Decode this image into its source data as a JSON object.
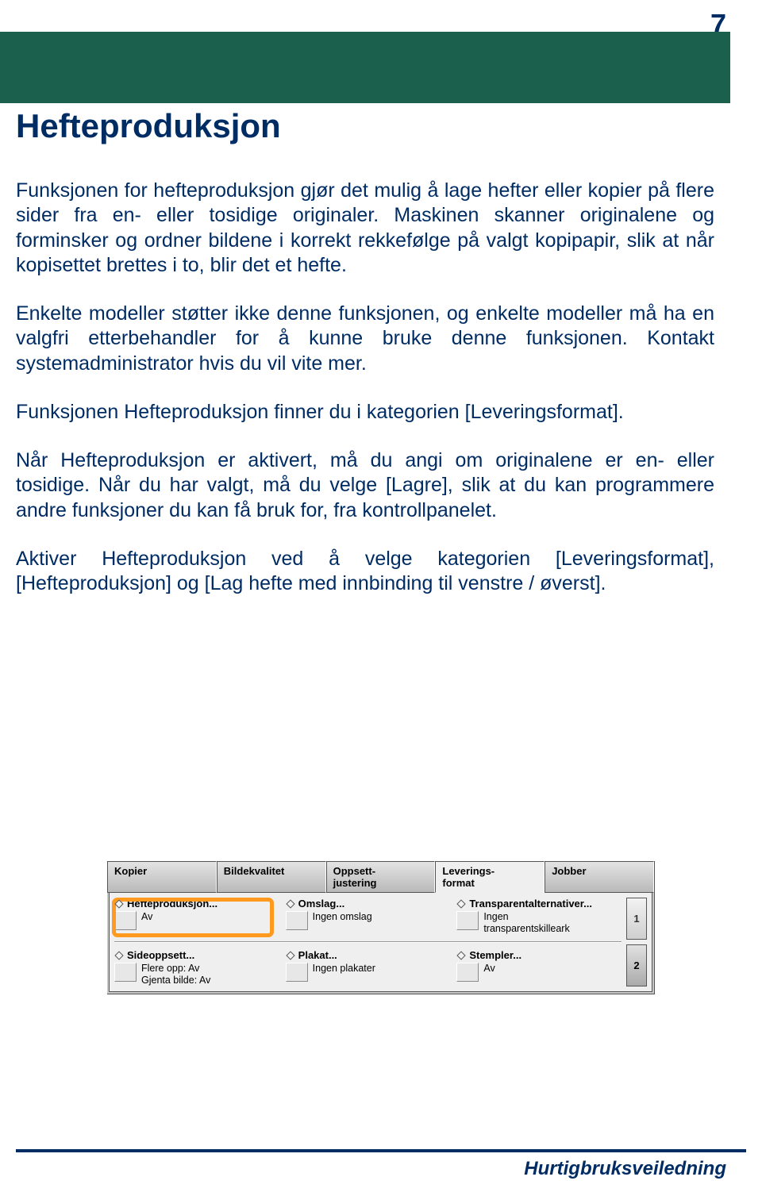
{
  "page_number": "7",
  "title": "Hefteproduksjon",
  "paragraphs": [
    "Funksjonen for hefteproduksjon gjør det mulig å lage hefter eller kopier på flere sider fra en- eller tosidige originaler. Maskinen skanner originalene og forminsker og ordner bildene i korrekt rekkefølge på valgt kopipapir, slik at når kopisettet brettes i to, blir det et hefte.",
    "Enkelte modeller støtter ikke denne funksjonen, og enkelte modeller må ha en valgfri etterbehandler for å kunne bruke denne funksjonen. Kontakt systemadministrator hvis du vil vite mer.",
    "Funksjonen Hefteproduksjon finner du i kategorien [Leveringsformat].",
    "Når Hefteproduksjon er aktivert, må du angi om originalene er en- eller tosidige. Når du har valgt, må du velge [Lagre], slik at du kan programmere andre funksjoner du kan få bruk for, fra kontrollpanelet.",
    "Aktiver Hefteproduksjon ved å velge kategorien [Leveringsformat], [Hefteproduksjon] og [Lag hefte med innbinding til venstre / øverst]."
  ],
  "ui": {
    "tabs": [
      "Kopier",
      "Bildekvalitet",
      "Oppsett-\njustering",
      "Leverings-\nformat",
      "Jobber"
    ],
    "active_tab_index": 3,
    "options": [
      {
        "title": "Hefteproduksjon...",
        "detail": "Av"
      },
      {
        "title": "Omslag...",
        "detail": "Ingen omslag"
      },
      {
        "title": "Transparentalternativer...",
        "detail": "Ingen\ntransparentskilleark"
      },
      {
        "title": "Sideoppsett...",
        "detail": "Flere opp: Av\nGjenta bilde: Av"
      },
      {
        "title": "Plakat...",
        "detail": "Ingen plakater"
      },
      {
        "title": "Stempler...",
        "detail": "Av"
      }
    ],
    "side": {
      "p1": "1",
      "p2": "2"
    }
  },
  "footer": "Hurtigbruksveiledning"
}
